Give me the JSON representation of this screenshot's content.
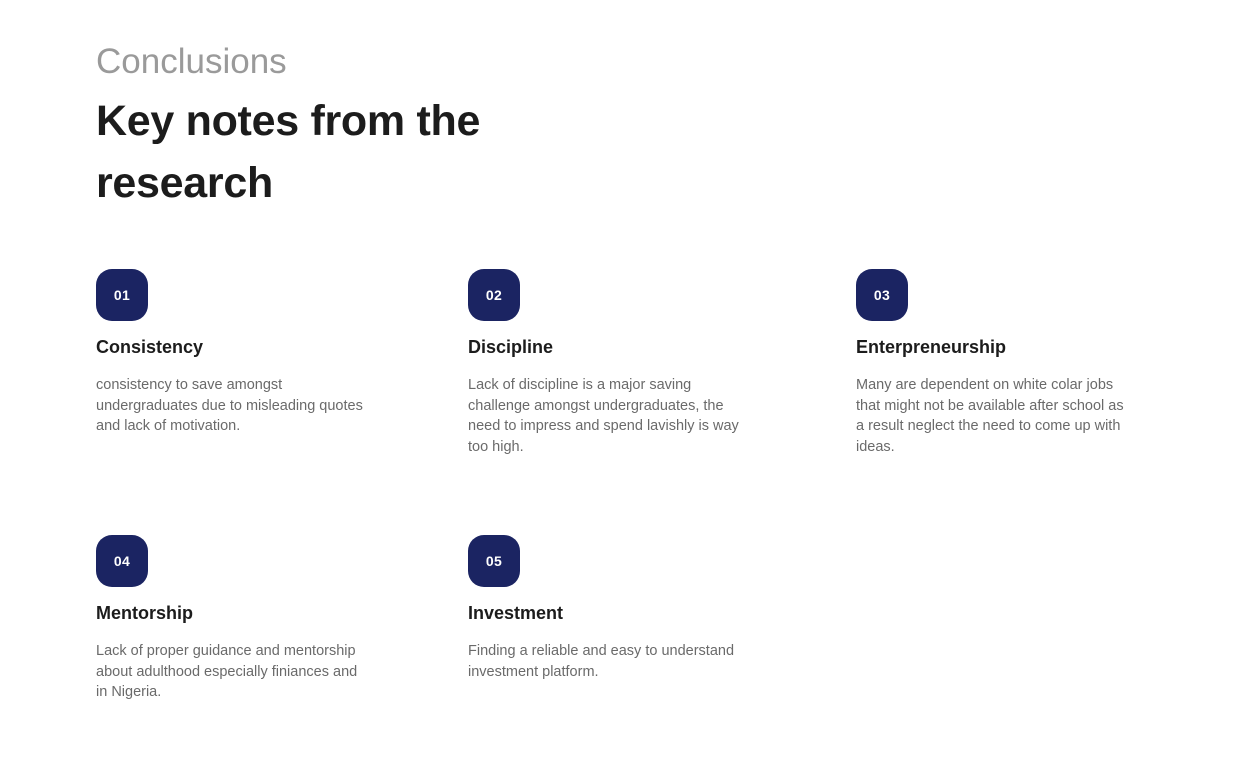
{
  "header": {
    "eyebrow": "Conclusions",
    "title": "Key notes from the research"
  },
  "notes": [
    {
      "number": "01",
      "title": "Consistency",
      "text": "consistency to save amongst undergraduates due to misleading quotes and lack of motivation."
    },
    {
      "number": "02",
      "title": "Discipline",
      "text": "Lack of discipline is a major saving challenge amongst undergraduates, the need to impress and spend lavishly is way too high."
    },
    {
      "number": "03",
      "title": "Enterpreneurship",
      "text": "Many are dependent on white colar jobs that might not be available after school as a result neglect the need to come up with ideas."
    },
    {
      "number": "04",
      "title": "Mentorship",
      "text": "Lack of proper guidance and mentorship about adulthood especially finiances and in Nigeria."
    },
    {
      "number": "05",
      "title": "Investment",
      "text": "Finding a reliable and easy to understand investment platform."
    }
  ],
  "colors": {
    "badge": "#1b2462",
    "heading": "#1c1c1c",
    "eyebrow": "#9a9a9a",
    "body": "#6a6a6a"
  }
}
